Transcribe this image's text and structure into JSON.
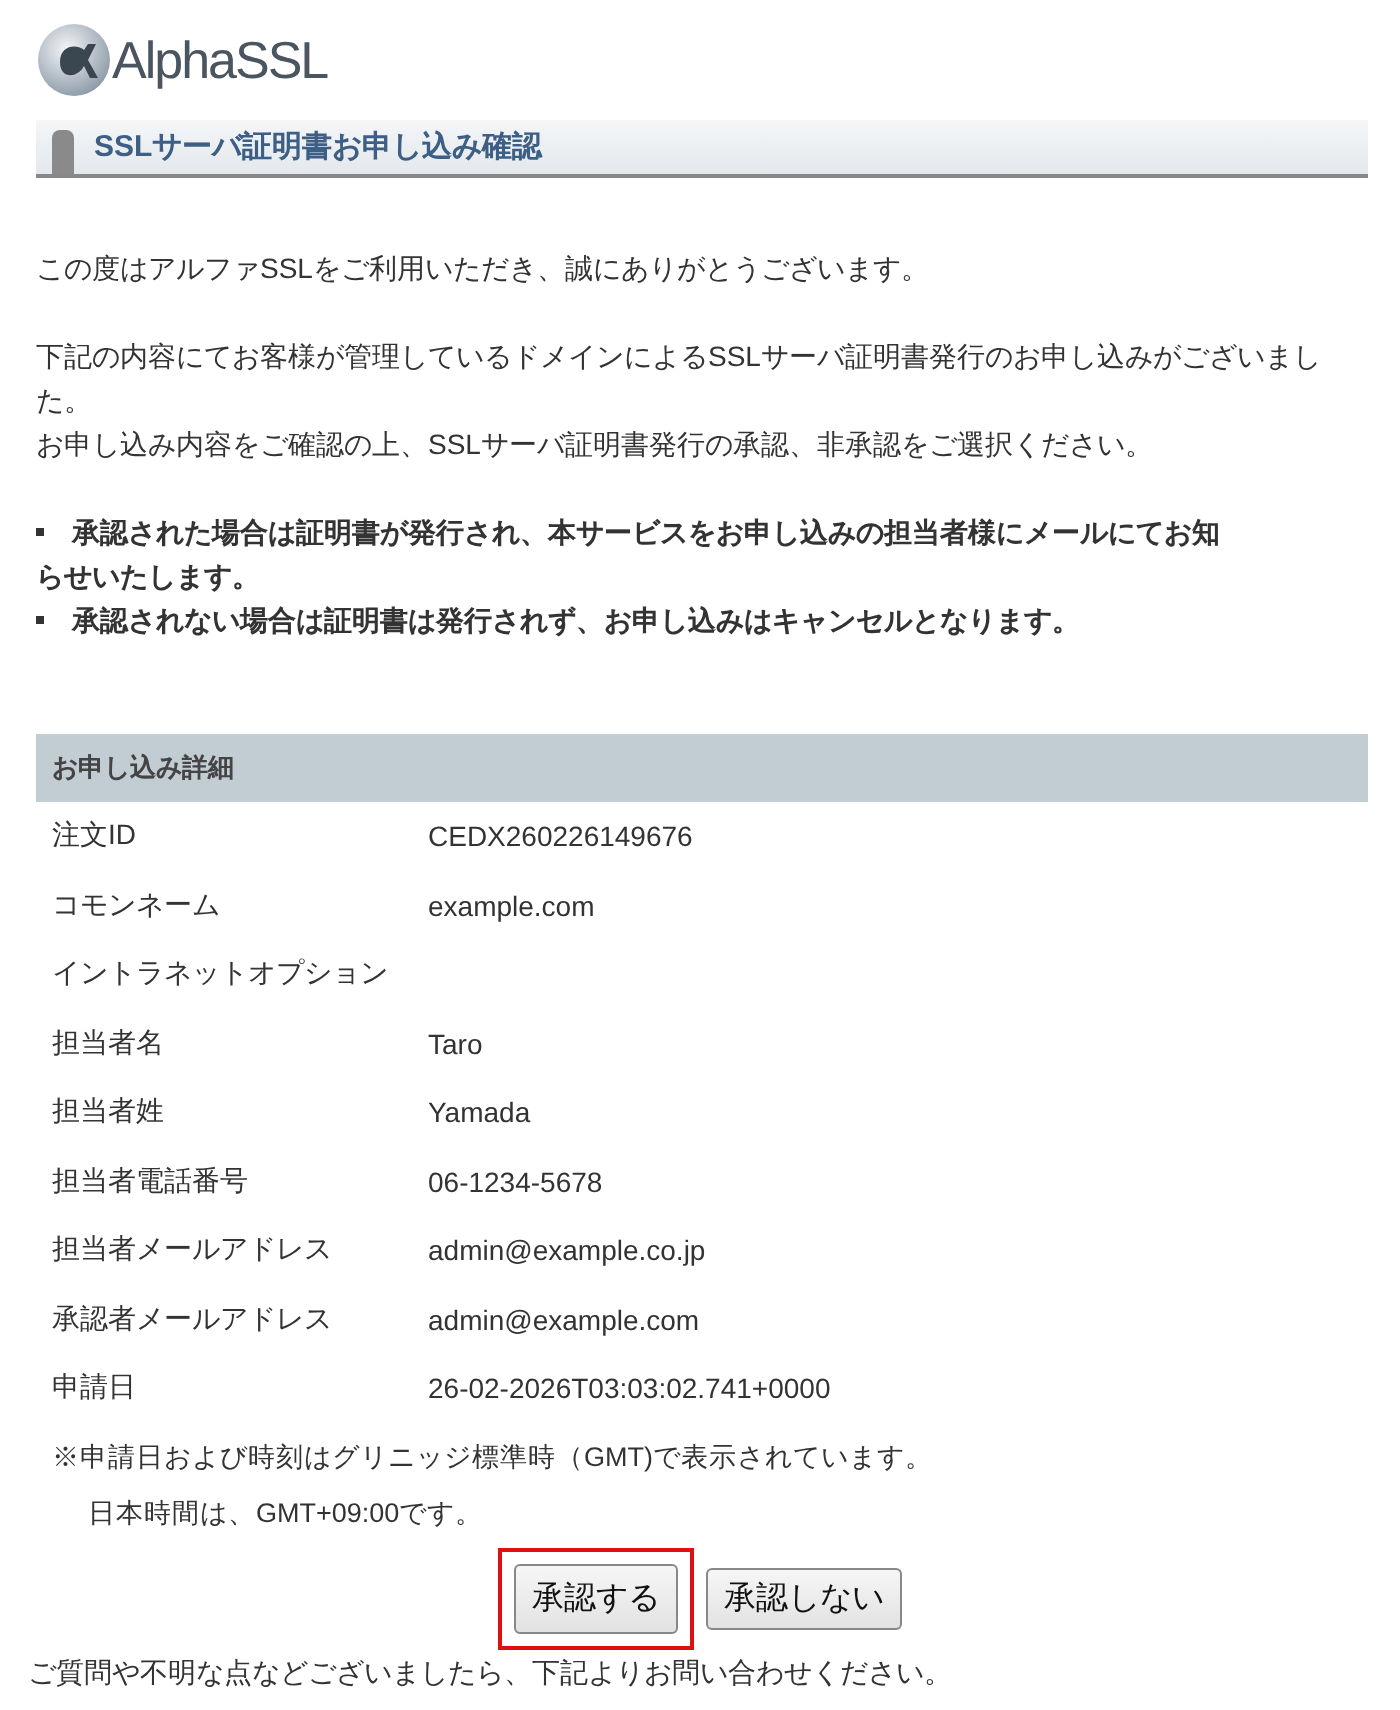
{
  "logo": {
    "text": "AlphaSSL"
  },
  "page_title": "SSLサーバ証明書お申し込み確認",
  "intro": [
    "この度はアルファSSLをご利用いただき、誠にありがとうございます。",
    "下記の内容にてお客様が管理しているドメインによるSSLサーバ証明書発行のお申し込みがございました。",
    "お申し込み内容をご確認の上、SSLサーバ証明書発行の承認、非承認をご選択ください。"
  ],
  "notes": [
    "承認された場合は証明書が発行され、本サービスをお申し込みの担当者様にメールにてお知らせいたします。",
    "承認されない場合は証明書は発行されず、お申し込みはキャンセルとなります。"
  ],
  "details": {
    "heading": "お申し込み詳細",
    "rows": [
      {
        "label": "注文ID",
        "value": "CEDX260226149676"
      },
      {
        "label": "コモンネーム",
        "value": "example.com"
      },
      {
        "label": "イントラネットオプション"
      },
      {
        "label": "担当者名",
        "value": "Taro"
      },
      {
        "label": "担当者姓",
        "value": "Yamada"
      },
      {
        "label": "担当者電話番号",
        "value": "06-1234-5678"
      },
      {
        "label": "担当者メールアドレス",
        "value": "admin@example.co.jp"
      },
      {
        "label": "承認者メールアドレス",
        "value": "admin@example.com"
      },
      {
        "label": "申請日",
        "value": "26-02-2026T03:03:02.741+0000"
      }
    ]
  },
  "time_note": [
    "※申請日および時刻はグリニッジ標準時（GMT)で表示されています。",
    "日本時間は、GMT+09:00です。"
  ],
  "buttons": [
    {
      "label": "承認する",
      "highlighted": true
    },
    {
      "label": "承認しない",
      "highlighted": false
    }
  ],
  "footer": "ご質問や不明な点などございましたら、下記よりお問い合わせください。"
}
